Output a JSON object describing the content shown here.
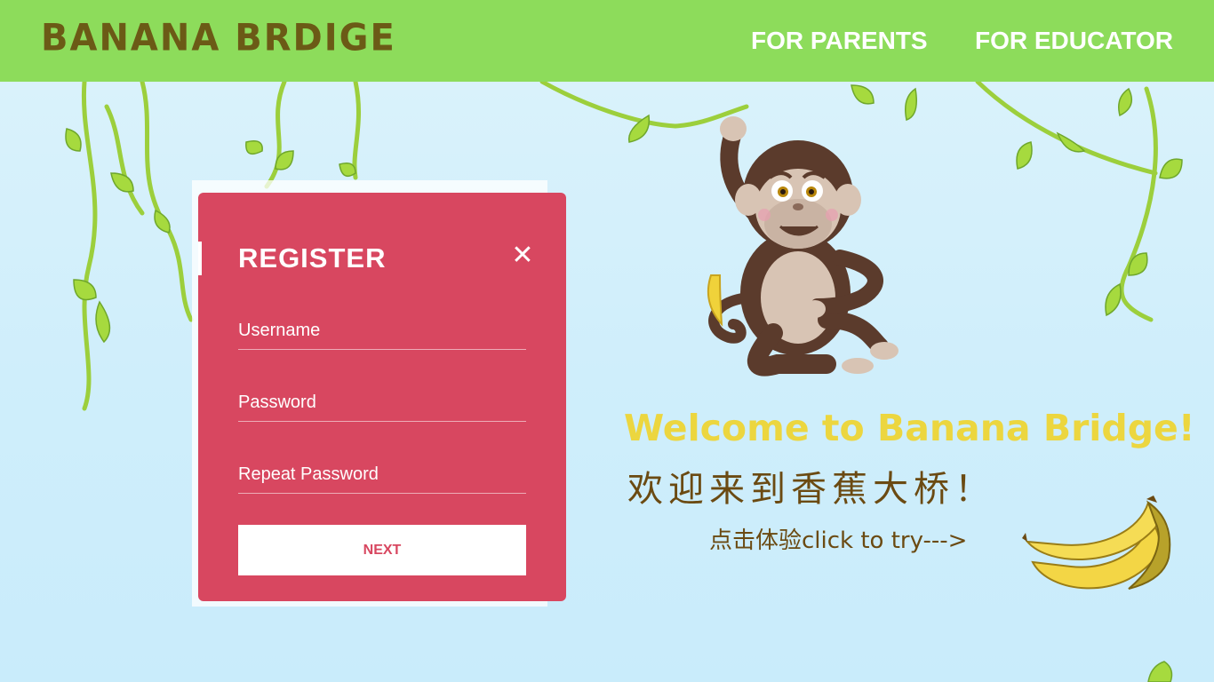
{
  "header": {
    "brand": "BANANA BRDIGE",
    "nav": [
      {
        "label": "FOR PARENTS"
      },
      {
        "label": "FOR EDUCATOR"
      }
    ]
  },
  "register": {
    "title": "REGISTER",
    "close_label": "✕",
    "fields": [
      {
        "placeholder": "Username",
        "value": ""
      },
      {
        "placeholder": "Password",
        "value": ""
      },
      {
        "placeholder": "Repeat Password",
        "value": ""
      }
    ],
    "next_label": "NEXT"
  },
  "welcome": {
    "english": "Welcome to Banana Bridge!",
    "chinese": "欢迎来到香蕉大桥！",
    "try_link": "点击体验click to try--->"
  },
  "icons": {
    "close": "close-icon",
    "monkey": "monkey-illustration",
    "bananas": "banana-bunch-illustration",
    "vines": "vine-decoration"
  },
  "colors": {
    "header_bg": "#8ddc5b",
    "brand_text": "#6b5a16",
    "card_bg": "#d84760",
    "welcome_yellow": "#ecd63f",
    "text_brown": "#6b4a12"
  }
}
